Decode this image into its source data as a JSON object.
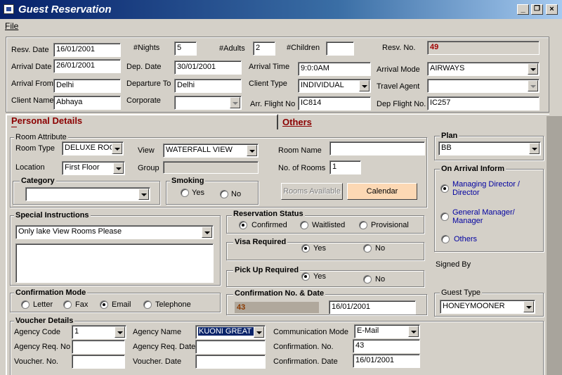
{
  "window": {
    "title": "Guest Reservation"
  },
  "menu": {
    "file": "File"
  },
  "top": {
    "resv_date_label": "Resv. Date",
    "resv_date": "16/01/2001",
    "nights_label": "#Nights",
    "nights": "5",
    "adults_label": "#Adults",
    "adults": "2",
    "children_label": "#Children",
    "children": "",
    "resv_no_label": "Resv. No.",
    "resv_no": "49",
    "arrival_date_label": "Arrival Date",
    "arrival_date": "26/01/2001",
    "dep_date_label": "Dep. Date",
    "dep_date": "30/01/2001",
    "arrival_time_label": "Arrival Time",
    "arrival_time": "9:0:0AM",
    "arrival_mode_label": "Arrival Mode",
    "arrival_mode": "AIRWAYS",
    "arrival_from_label": "Arrival From",
    "arrival_from": "Delhi",
    "departure_to_label": "Departure To",
    "departure_to": "Delhi",
    "client_type_label": "Client Type",
    "client_type": "INDIVIDUAL",
    "travel_agent_label": "Travel Agent",
    "travel_agent": "",
    "client_name_label": "Client Name",
    "client_name": "Abhaya",
    "corporate_label": "Corporate",
    "corporate": "",
    "arr_flight_label": "Arr. Flight No",
    "arr_flight": "IC814",
    "dep_flight_label": "Dep Flight No.",
    "dep_flight": "IC257"
  },
  "tabs": {
    "personal": "Personal Details",
    "others": "Others"
  },
  "room": {
    "group_title": "Room Attribute",
    "room_type_label": "Room Type",
    "room_type": "DELUXE ROO",
    "view_label": "View",
    "view": "WATERFALL VIEW",
    "room_name_label": "Room Name",
    "room_name": "",
    "location_label": "Location",
    "location": "First Floor",
    "group_label": "Group",
    "group": "",
    "no_rooms_label": "No. of Rooms",
    "no_rooms": "1",
    "category_title": "Category",
    "category": "",
    "smoking_title": "Smoking",
    "smoking_yes": "Yes",
    "smoking_no": "No",
    "rooms_available": "Rooms Available",
    "calendar": "Calendar"
  },
  "plan": {
    "title": "Plan",
    "value": "BB"
  },
  "arrival_inform": {
    "title": "On Arrival Inform",
    "opt1": "Managing Director / Director",
    "opt2": "General Manager/ Manager",
    "opt3": "Others"
  },
  "special": {
    "title": "Special Instructions",
    "value": "Only lake View Rooms Please",
    "notes": ""
  },
  "reservation_status": {
    "title": "Reservation Status",
    "confirmed": "Confirmed",
    "waitlisted": "Waitlisted",
    "provisional": "Provisional"
  },
  "visa": {
    "title": "Visa Required",
    "yes": "Yes",
    "no": "No"
  },
  "pickup": {
    "title": "Pick Up Required",
    "yes": "Yes",
    "no": "No"
  },
  "signed_by": "Signed  By",
  "confirmation_mode": {
    "title": "Confirmation Mode",
    "letter": "Letter",
    "fax": "Fax",
    "email": "Email",
    "telephone": "Telephone"
  },
  "confirmation_no": {
    "title": "Confirmation No. & Date",
    "number": "43",
    "date": "16/01/2001"
  },
  "guest_type": {
    "title": "Guest Type",
    "value": "HONEYMOONER"
  },
  "voucher": {
    "title": "Voucher Details",
    "agency_code_label": "Agency Code",
    "agency_code": "1",
    "agency_name_label": "Agency Name",
    "agency_name": "KUONI GREAT E",
    "comm_mode_label": "Communication Mode",
    "comm_mode": "E-Mail",
    "agency_req_no_label": "Agency Req. No",
    "agency_req_no": "",
    "agency_req_date_label": "Agency Req. Date",
    "agency_req_date": "",
    "conf_no_label": "Confirmation. No.",
    "conf_no": "43",
    "voucher_no_label": "Voucher. No.",
    "voucher_no": "",
    "voucher_date_label": "Voucher. Date",
    "voucher_date": "",
    "conf_date_label": "Confirmation. Date",
    "conf_date": "16/01/2001"
  },
  "colors": {
    "title_start": "#06206a",
    "tab_label": "#8b0000",
    "highlight": "#0a246a",
    "conf_no_bg": "#b0a89c"
  }
}
